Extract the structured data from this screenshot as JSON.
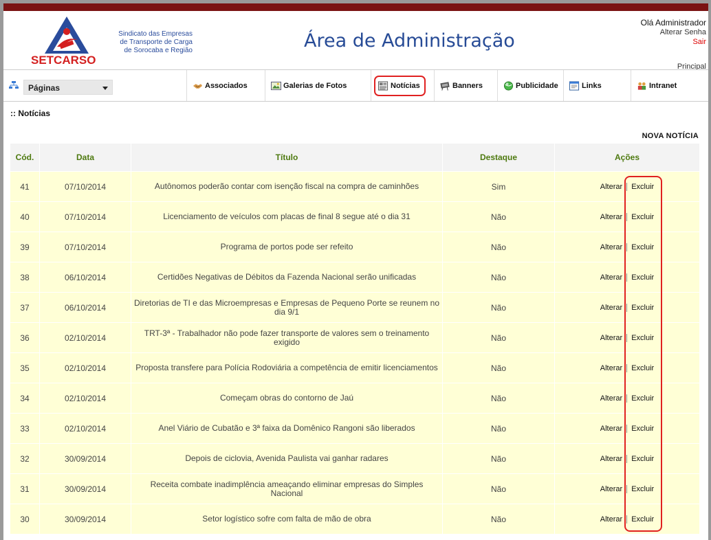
{
  "header": {
    "logo_text": "Sindicato das Empresas de Transporte de Carga de Sorocaba e Região",
    "logo_line1": "Sindicato das Empresas",
    "logo_line2": "de Transporte de Carga",
    "logo_line3": "de Sorocaba e Região",
    "brand": "SETCARSO",
    "title": "Área de Administração",
    "greeting": "Olá Administrador",
    "change_password": "Alterar Senha",
    "logout": "Sair",
    "principal": "Principal"
  },
  "nav": {
    "pages_select": "Páginas",
    "items": [
      {
        "label": "Associados",
        "icon": "handshake-icon"
      },
      {
        "label": "Galerias de Fotos",
        "icon": "photo-gallery-icon"
      },
      {
        "label": "Notícias",
        "icon": "newspaper-icon"
      },
      {
        "label": "Banners",
        "icon": "banner-icon"
      },
      {
        "label": "Publicidade",
        "icon": "globe-icon"
      },
      {
        "label": "Links",
        "icon": "window-icon"
      },
      {
        "label": "Intranet",
        "icon": "users-icon"
      }
    ],
    "active": "Notícias"
  },
  "section_title": ":: Notícias",
  "new_news": "NOVA NOTÍCIA",
  "table": {
    "headers": [
      "Cód.",
      "Data",
      "Título",
      "Destaque",
      "Ações"
    ],
    "action_edit": "Alterar",
    "action_delete": "Excluir",
    "rows": [
      {
        "cod": "41",
        "data": "07/10/2014",
        "titulo": "Autônomos poderão contar com isenção fiscal na compra de caminhões",
        "destaque": "Sim"
      },
      {
        "cod": "40",
        "data": "07/10/2014",
        "titulo": "Licenciamento de veículos com placas de final 8 segue até o dia 31",
        "destaque": "Não"
      },
      {
        "cod": "39",
        "data": "07/10/2014",
        "titulo": "Programa de portos pode ser refeito",
        "destaque": "Não"
      },
      {
        "cod": "38",
        "data": "06/10/2014",
        "titulo": "Certidões Negativas de Débitos da Fazenda Nacional serão unificadas",
        "destaque": "Não"
      },
      {
        "cod": "37",
        "data": "06/10/2014",
        "titulo": "Diretorias de TI e das Microempresas e Empresas de Pequeno Porte se reunem no dia 9/1",
        "destaque": "Não"
      },
      {
        "cod": "36",
        "data": "02/10/2014",
        "titulo": "TRT-3ª - Trabalhador não pode fazer transporte de valores sem o treinamento exigido",
        "destaque": "Não"
      },
      {
        "cod": "35",
        "data": "02/10/2014",
        "titulo": "Proposta transfere para Polícia Rodoviária a competência de emitir licenciamentos",
        "destaque": "Não"
      },
      {
        "cod": "34",
        "data": "02/10/2014",
        "titulo": "Começam obras do contorno de Jaú",
        "destaque": "Não"
      },
      {
        "cod": "33",
        "data": "02/10/2014",
        "titulo": "Anel Viário de Cubatão e 3ª faixa da Domênico Rangoni são liberados",
        "destaque": "Não"
      },
      {
        "cod": "32",
        "data": "30/09/2014",
        "titulo": "Depois de ciclovia, Avenida Paulista vai ganhar radares",
        "destaque": "Não"
      },
      {
        "cod": "31",
        "data": "30/09/2014",
        "titulo": "Receita combate inadimplência ameaçando eliminar empresas do Simples Nacional",
        "destaque": "Não"
      },
      {
        "cod": "30",
        "data": "30/09/2014",
        "titulo": "Setor logístico sofre com falta de mão de obra",
        "destaque": "Não"
      }
    ]
  },
  "colors": {
    "topbar": "#7b1414",
    "title": "#274b96",
    "header_text": "#4e7a10",
    "row_bg": "#ffffd6",
    "highlight": "#e02020"
  }
}
